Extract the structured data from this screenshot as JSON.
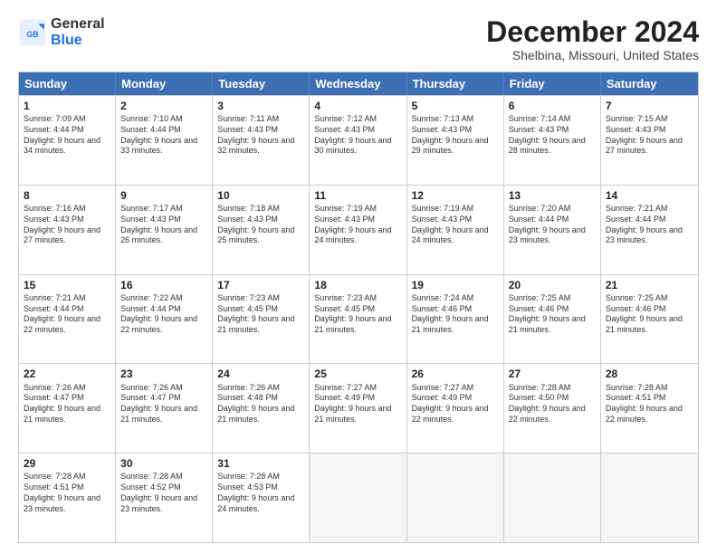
{
  "header": {
    "logo": {
      "line1": "General",
      "line2": "Blue"
    },
    "title": "December 2024",
    "location": "Shelbina, Missouri, United States"
  },
  "days": [
    "Sunday",
    "Monday",
    "Tuesday",
    "Wednesday",
    "Thursday",
    "Friday",
    "Saturday"
  ],
  "weeks": [
    [
      {
        "day": "1",
        "sunrise": "Sunrise: 7:09 AM",
        "sunset": "Sunset: 4:44 PM",
        "daylight": "Daylight: 9 hours and 34 minutes."
      },
      {
        "day": "2",
        "sunrise": "Sunrise: 7:10 AM",
        "sunset": "Sunset: 4:44 PM",
        "daylight": "Daylight: 9 hours and 33 minutes."
      },
      {
        "day": "3",
        "sunrise": "Sunrise: 7:11 AM",
        "sunset": "Sunset: 4:43 PM",
        "daylight": "Daylight: 9 hours and 32 minutes."
      },
      {
        "day": "4",
        "sunrise": "Sunrise: 7:12 AM",
        "sunset": "Sunset: 4:43 PM",
        "daylight": "Daylight: 9 hours and 30 minutes."
      },
      {
        "day": "5",
        "sunrise": "Sunrise: 7:13 AM",
        "sunset": "Sunset: 4:43 PM",
        "daylight": "Daylight: 9 hours and 29 minutes."
      },
      {
        "day": "6",
        "sunrise": "Sunrise: 7:14 AM",
        "sunset": "Sunset: 4:43 PM",
        "daylight": "Daylight: 9 hours and 28 minutes."
      },
      {
        "day": "7",
        "sunrise": "Sunrise: 7:15 AM",
        "sunset": "Sunset: 4:43 PM",
        "daylight": "Daylight: 9 hours and 27 minutes."
      }
    ],
    [
      {
        "day": "8",
        "sunrise": "Sunrise: 7:16 AM",
        "sunset": "Sunset: 4:43 PM",
        "daylight": "Daylight: 9 hours and 27 minutes."
      },
      {
        "day": "9",
        "sunrise": "Sunrise: 7:17 AM",
        "sunset": "Sunset: 4:43 PM",
        "daylight": "Daylight: 9 hours and 26 minutes."
      },
      {
        "day": "10",
        "sunrise": "Sunrise: 7:18 AM",
        "sunset": "Sunset: 4:43 PM",
        "daylight": "Daylight: 9 hours and 25 minutes."
      },
      {
        "day": "11",
        "sunrise": "Sunrise: 7:19 AM",
        "sunset": "Sunset: 4:43 PM",
        "daylight": "Daylight: 9 hours and 24 minutes."
      },
      {
        "day": "12",
        "sunrise": "Sunrise: 7:19 AM",
        "sunset": "Sunset: 4:43 PM",
        "daylight": "Daylight: 9 hours and 24 minutes."
      },
      {
        "day": "13",
        "sunrise": "Sunrise: 7:20 AM",
        "sunset": "Sunset: 4:44 PM",
        "daylight": "Daylight: 9 hours and 23 minutes."
      },
      {
        "day": "14",
        "sunrise": "Sunrise: 7:21 AM",
        "sunset": "Sunset: 4:44 PM",
        "daylight": "Daylight: 9 hours and 23 minutes."
      }
    ],
    [
      {
        "day": "15",
        "sunrise": "Sunrise: 7:21 AM",
        "sunset": "Sunset: 4:44 PM",
        "daylight": "Daylight: 9 hours and 22 minutes."
      },
      {
        "day": "16",
        "sunrise": "Sunrise: 7:22 AM",
        "sunset": "Sunset: 4:44 PM",
        "daylight": "Daylight: 9 hours and 22 minutes."
      },
      {
        "day": "17",
        "sunrise": "Sunrise: 7:23 AM",
        "sunset": "Sunset: 4:45 PM",
        "daylight": "Daylight: 9 hours and 21 minutes."
      },
      {
        "day": "18",
        "sunrise": "Sunrise: 7:23 AM",
        "sunset": "Sunset: 4:45 PM",
        "daylight": "Daylight: 9 hours and 21 minutes."
      },
      {
        "day": "19",
        "sunrise": "Sunrise: 7:24 AM",
        "sunset": "Sunset: 4:46 PM",
        "daylight": "Daylight: 9 hours and 21 minutes."
      },
      {
        "day": "20",
        "sunrise": "Sunrise: 7:25 AM",
        "sunset": "Sunset: 4:46 PM",
        "daylight": "Daylight: 9 hours and 21 minutes."
      },
      {
        "day": "21",
        "sunrise": "Sunrise: 7:25 AM",
        "sunset": "Sunset: 4:46 PM",
        "daylight": "Daylight: 9 hours and 21 minutes."
      }
    ],
    [
      {
        "day": "22",
        "sunrise": "Sunrise: 7:26 AM",
        "sunset": "Sunset: 4:47 PM",
        "daylight": "Daylight: 9 hours and 21 minutes."
      },
      {
        "day": "23",
        "sunrise": "Sunrise: 7:26 AM",
        "sunset": "Sunset: 4:47 PM",
        "daylight": "Daylight: 9 hours and 21 minutes."
      },
      {
        "day": "24",
        "sunrise": "Sunrise: 7:26 AM",
        "sunset": "Sunset: 4:48 PM",
        "daylight": "Daylight: 9 hours and 21 minutes."
      },
      {
        "day": "25",
        "sunrise": "Sunrise: 7:27 AM",
        "sunset": "Sunset: 4:49 PM",
        "daylight": "Daylight: 9 hours and 21 minutes."
      },
      {
        "day": "26",
        "sunrise": "Sunrise: 7:27 AM",
        "sunset": "Sunset: 4:49 PM",
        "daylight": "Daylight: 9 hours and 22 minutes."
      },
      {
        "day": "27",
        "sunrise": "Sunrise: 7:28 AM",
        "sunset": "Sunset: 4:50 PM",
        "daylight": "Daylight: 9 hours and 22 minutes."
      },
      {
        "day": "28",
        "sunrise": "Sunrise: 7:28 AM",
        "sunset": "Sunset: 4:51 PM",
        "daylight": "Daylight: 9 hours and 22 minutes."
      }
    ],
    [
      {
        "day": "29",
        "sunrise": "Sunrise: 7:28 AM",
        "sunset": "Sunset: 4:51 PM",
        "daylight": "Daylight: 9 hours and 23 minutes."
      },
      {
        "day": "30",
        "sunrise": "Sunrise: 7:28 AM",
        "sunset": "Sunset: 4:52 PM",
        "daylight": "Daylight: 9 hours and 23 minutes."
      },
      {
        "day": "31",
        "sunrise": "Sunrise: 7:28 AM",
        "sunset": "Sunset: 4:53 PM",
        "daylight": "Daylight: 9 hours and 24 minutes."
      },
      null,
      null,
      null,
      null
    ]
  ]
}
